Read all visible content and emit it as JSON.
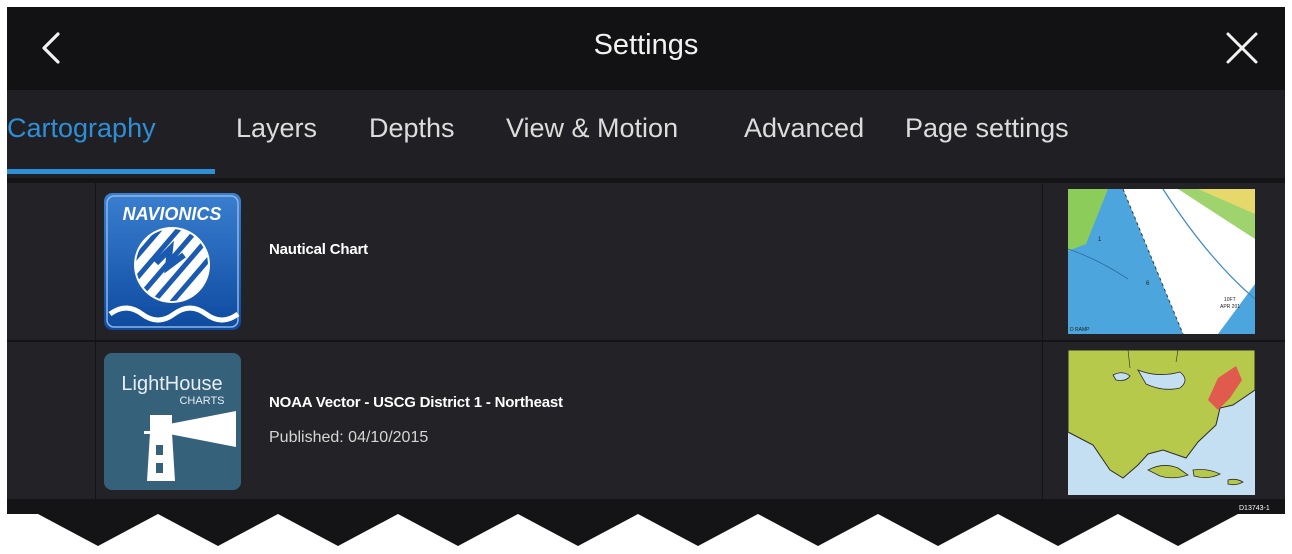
{
  "header": {
    "title": "Settings",
    "back_icon": "chevron-left-icon",
    "close_icon": "close-icon"
  },
  "tabs": [
    {
      "label": "Cartography",
      "active": true
    },
    {
      "label": "Layers",
      "active": false
    },
    {
      "label": "Depths",
      "active": false
    },
    {
      "label": "View & Motion",
      "active": false
    },
    {
      "label": "Advanced",
      "active": false
    },
    {
      "label": "Page settings",
      "active": false
    }
  ],
  "charts": [
    {
      "logo_text": "NAVIONICS",
      "title": "Nautical Chart",
      "subtitle": "",
      "thumb_labels": [
        "1",
        "6",
        "10FT",
        "APR 201",
        "D RAMP"
      ]
    },
    {
      "logo_text_main": "LightHouse",
      "logo_text_sub": "CHARTS",
      "title": "NOAA Vector - USCG District 1 - Northeast",
      "subtitle": "Published: 04/10/2015"
    }
  ],
  "figure_code": "D13743-1",
  "colors": {
    "accent": "#2e8fd6",
    "header_bg": "#121214",
    "row_bg": "#232327"
  }
}
